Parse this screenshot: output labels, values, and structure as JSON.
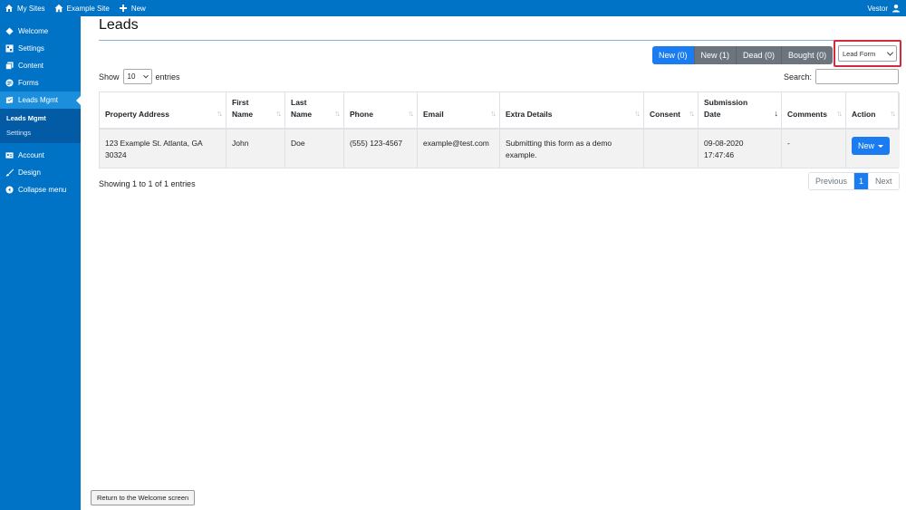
{
  "adminbar": {
    "my_sites": "My Sites",
    "site_name": "Example Site",
    "new_label": "New",
    "user_name": "Vestor"
  },
  "sidebar": {
    "items": [
      {
        "label": "Welcome",
        "icon": "diamond-icon"
      },
      {
        "label": "Settings",
        "icon": "settings-panel-icon"
      },
      {
        "label": "Content",
        "icon": "pages-icon"
      },
      {
        "label": "Forms",
        "icon": "forms-icon"
      },
      {
        "label": "Leads Mgmt",
        "icon": "leads-icon"
      }
    ],
    "submenu": [
      "Leads Mgmt",
      "Settings"
    ],
    "bottom_items": [
      {
        "label": "Account",
        "icon": "id-card-icon"
      },
      {
        "label": "Design",
        "icon": "brush-icon"
      },
      {
        "label": "Collapse menu",
        "icon": "collapse-icon"
      }
    ]
  },
  "page": {
    "title": "Leads",
    "status_tabs": [
      "New (0)",
      "New (1)",
      "Dead (0)",
      "Bought (0)"
    ],
    "form_select": "Lead Form",
    "show_label": "Show",
    "entries_value": "10",
    "entries_label": "entries",
    "search_label": "Search:"
  },
  "table": {
    "headers": [
      "Property Address",
      "First Name",
      "Last Name",
      "Phone",
      "Email",
      "Extra Details",
      "Consent",
      "Submission Date",
      "Comments",
      "Action"
    ],
    "rows": [
      {
        "address": "123 Example St. Atlanta, GA 30324",
        "first": "John",
        "last": "Doe",
        "phone": "(555) 123-4567",
        "email": "example@test.com",
        "details": "Submitting this form as a demo example.",
        "consent": "",
        "date": "09-08-2020 17:47:46",
        "comments": "-",
        "action": "New"
      }
    ]
  },
  "footer": {
    "info": "Showing 1 to 1 of 1 entries",
    "previous": "Previous",
    "page": "1",
    "next": "Next",
    "return_button": "Return to the Welcome screen"
  },
  "colors": {
    "wp_blue": "#0073c6",
    "primary": "#1a7cf0",
    "secondary": "#6c757d",
    "highlight_border": "#d42a3f"
  }
}
